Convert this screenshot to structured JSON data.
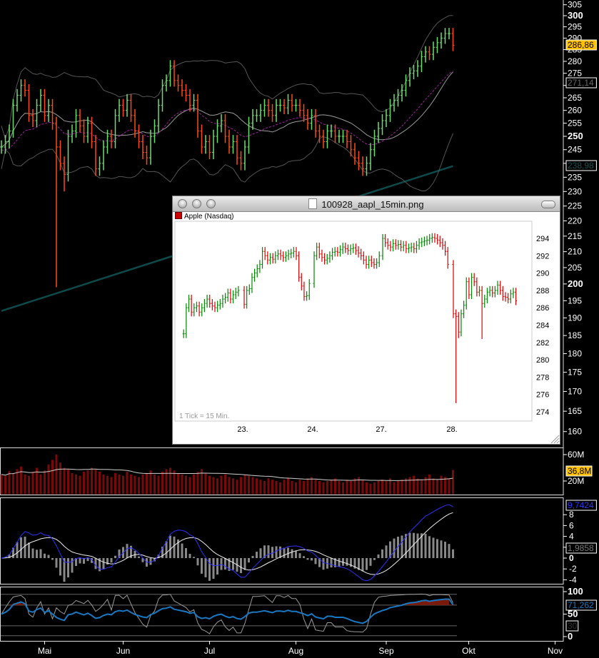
{
  "chart_data": [
    {
      "type": "ohlc",
      "title": "AAPL daily",
      "scale": "log",
      "ylim": [
        158,
        306
      ],
      "y_ticks": [
        305,
        300,
        295,
        290,
        285,
        280,
        275,
        270,
        265,
        260,
        255,
        250,
        245,
        240,
        235,
        230,
        225,
        220,
        215,
        210,
        205,
        200,
        195,
        190,
        185,
        180,
        175,
        170,
        165,
        160
      ],
      "y_bold": [
        300,
        250,
        200
      ],
      "x_labels": [
        "Mai",
        "Jun",
        "Jul",
        "Aug",
        "Sep",
        "Okt",
        "Nov"
      ],
      "x_label_bar_index": [
        11,
        31,
        53,
        75,
        98,
        119,
        141
      ],
      "close": [
        246,
        248,
        252,
        262,
        266,
        270,
        268,
        258,
        256,
        262,
        266,
        258,
        262,
        255,
        246,
        240,
        236,
        250,
        252,
        258,
        254,
        250,
        255,
        248,
        238,
        240,
        246,
        250,
        248,
        258,
        262,
        260,
        264,
        258,
        252,
        248,
        244,
        242,
        250,
        254,
        262,
        270,
        272,
        278,
        272,
        270,
        268,
        266,
        262,
        264,
        252,
        246,
        248,
        244,
        250,
        254,
        256,
        250,
        246,
        248,
        242,
        240,
        246,
        255,
        258,
        258,
        260,
        262,
        260,
        258,
        262,
        262,
        261,
        264,
        262,
        262,
        260,
        258,
        255,
        258,
        252,
        250,
        248,
        252,
        252,
        250,
        250,
        250,
        248,
        245,
        242,
        240,
        238,
        240,
        245,
        250,
        253,
        256,
        258,
        262,
        264,
        266,
        268,
        272,
        275,
        276,
        278,
        282,
        284,
        283,
        286,
        288,
        290,
        292,
        292,
        286.86
      ],
      "bar_range": 2.5,
      "low_overrides": {
        "14": 199,
        "16": 230
      },
      "ma200": {
        "start": 192,
        "end": 239
      },
      "badges": {
        "last": "286,86",
        "bb": "271,14",
        "ma200": "238,98"
      },
      "colors": {
        "up": "#6fdc6f",
        "down": "#ff4a10",
        "bb_outer": "#555555",
        "bb_mid": "#9a9a9a",
        "ema": "#a020a0",
        "ma200": "#0e4a4a",
        "last": "#ffc000"
      }
    },
    {
      "type": "bar",
      "title": "Volume",
      "unit": "M",
      "y_ticks": [
        "60M",
        "20M"
      ],
      "values": [
        30,
        28,
        35,
        32,
        38,
        42,
        30,
        28,
        34,
        40,
        30,
        36,
        45,
        52,
        60,
        48,
        40,
        38,
        32,
        30,
        28,
        34,
        36,
        40,
        38,
        34,
        30,
        28,
        26,
        32,
        30,
        28,
        34,
        30,
        28,
        26,
        30,
        32,
        36,
        30,
        28,
        34,
        38,
        40,
        36,
        32,
        30,
        28,
        26,
        30,
        34,
        38,
        32,
        28,
        26,
        24,
        28,
        30,
        26,
        24,
        22,
        26,
        30,
        28,
        26,
        24,
        22,
        20,
        24,
        22,
        20,
        18,
        22,
        24,
        20,
        18,
        22,
        20,
        24,
        26,
        22,
        20,
        18,
        20,
        22,
        24,
        20,
        18,
        22,
        20,
        24,
        26,
        22,
        18,
        16,
        18,
        20,
        22,
        20,
        24,
        18,
        20,
        22,
        24,
        26,
        28,
        24,
        22,
        26,
        30,
        24,
        22,
        28,
        26,
        24,
        36.8
      ],
      "badge": "36,8M"
    },
    {
      "type": "line",
      "title": "MACD",
      "y_ticks": [
        "8",
        "6",
        "4",
        "2",
        "0",
        "-2",
        "-4"
      ],
      "badges": {
        "macd": "9,7424",
        "hist": "1,9858"
      }
    },
    {
      "type": "line",
      "title": "RSI / Stochastic",
      "y_ticks": [
        "100",
        "50",
        "0"
      ],
      "badges": {
        "rsi": "71,262",
        "level": "30"
      }
    },
    {
      "type": "ohlc",
      "title": "Apple (Nasdaq) 15 min",
      "ylim": [
        273,
        295.5
      ],
      "y_ticks": [
        294,
        292,
        290,
        288,
        286,
        284,
        282,
        280,
        278,
        276,
        274
      ],
      "days": [
        {
          "label": "",
          "close": [
            283,
            286,
            287,
            285.5,
            286,
            286.2,
            285.5,
            286,
            286.5,
            287,
            286.5,
            286.2,
            286,
            286.3,
            286.5,
            287,
            287.2,
            287.7,
            287,
            287.5,
            287.8,
            288
          ]
        },
        {
          "label": "23.",
          "close": [
            286.4,
            288,
            288.2,
            289.5,
            290,
            290.5,
            291,
            292.5,
            292,
            291.5,
            291.8,
            291.6,
            292,
            292.2,
            292,
            291.8,
            292,
            292.2,
            292.3,
            292.5,
            292,
            289.5,
            288.5,
            287.3,
            287.4,
            288.8
          ]
        },
        {
          "label": "24.",
          "close": [
            292,
            293,
            292.2,
            291.8,
            291.5,
            291.7,
            292,
            292.4,
            292.5,
            292.4,
            292.7,
            293,
            292.8,
            292.6,
            292.8,
            292.9,
            292.6,
            292.3,
            292,
            291.5,
            291,
            291.5,
            291.2,
            291,
            291.2,
            292
          ]
        },
        {
          "label": "27.",
          "close": [
            294,
            293.5,
            293.2,
            293,
            293.4,
            293.2,
            293.3,
            293,
            293.2,
            292.8,
            292.9,
            293,
            292.8,
            293.2,
            293.5,
            293.6,
            293.7,
            293.8,
            294,
            294.1,
            294,
            293.8,
            293.5,
            293.2,
            292.5,
            291
          ]
        },
        {
          "label": "28.",
          "close": [
            285.3,
            285,
            283.2,
            285.3,
            286.3,
            289,
            287.5,
            289.5,
            289,
            287.8,
            288,
            286.5,
            287,
            287.8,
            288,
            287.7,
            288,
            288.6,
            288,
            287.3,
            287.2,
            287,
            287.6,
            287.8,
            286.8
          ]
        }
      ],
      "low_overrides": {
        "4-1": 275,
        "4-2": 282.5,
        "4-11": 282.4
      },
      "bar_range": 0.5,
      "footnote": "1 Tick = 15 Min.",
      "colors": {
        "up": "#008800",
        "down": "#dd0000"
      }
    }
  ],
  "window": {
    "title": "100928_aapl_15min.png",
    "legend": "Apple (Nasdaq)"
  }
}
